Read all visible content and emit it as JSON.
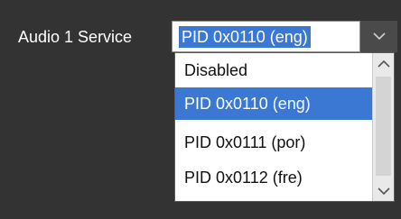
{
  "field": {
    "label": "Audio 1 Service",
    "selected_value": "PID 0x0110 (eng)"
  },
  "dropdown": {
    "options": [
      {
        "label": "Disabled",
        "selected": false
      },
      {
        "label": "PID 0x0110 (eng)",
        "selected": true
      },
      {
        "label": "PID 0x0111 (por)",
        "selected": false
      },
      {
        "label": "PID 0x0112 (fre)",
        "selected": false
      }
    ]
  },
  "icons": {
    "combo_button": "chevron-down-icon",
    "scroll_up": "arrow-up-icon",
    "scroll_down": "arrow-down-icon"
  },
  "colors": {
    "background": "#333333",
    "selection": "#3a78d4",
    "label_text": "#ffffff"
  }
}
